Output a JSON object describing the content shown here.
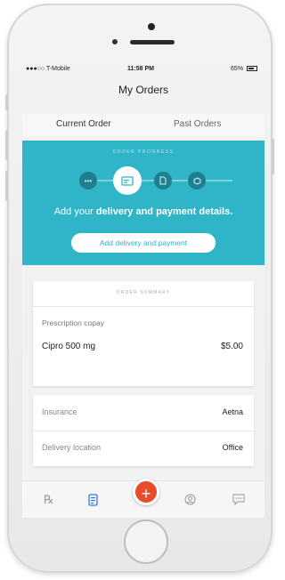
{
  "status_bar": {
    "carrier": "●●●○○ T-Mobile",
    "time": "11:58 PM",
    "battery": "65%"
  },
  "nav": {
    "title": "My Orders"
  },
  "tabs": {
    "current": "Current Order",
    "past": "Past Orders"
  },
  "progress": {
    "label": "ORDER PROGRESS",
    "headline_prefix": "Add your",
    "headline_bold": "delivery and payment details.",
    "button": "Add delivery and payment",
    "accent": "#2fb4c8",
    "steps": [
      "ellipsis-icon",
      "card-icon",
      "document-icon",
      "package-icon"
    ]
  },
  "summary": {
    "label": "ORDER SUMMARY",
    "copay_label": "Prescription copay",
    "medication": "Cipro 500 mg",
    "price": "$5.00"
  },
  "details": [
    {
      "key": "Insurance",
      "value": "Aetna"
    },
    {
      "key": "Delivery location",
      "value": "Office"
    }
  ],
  "tabbar": {
    "rx": "℞",
    "fab": "+",
    "fab_color": "#e84c2b"
  }
}
